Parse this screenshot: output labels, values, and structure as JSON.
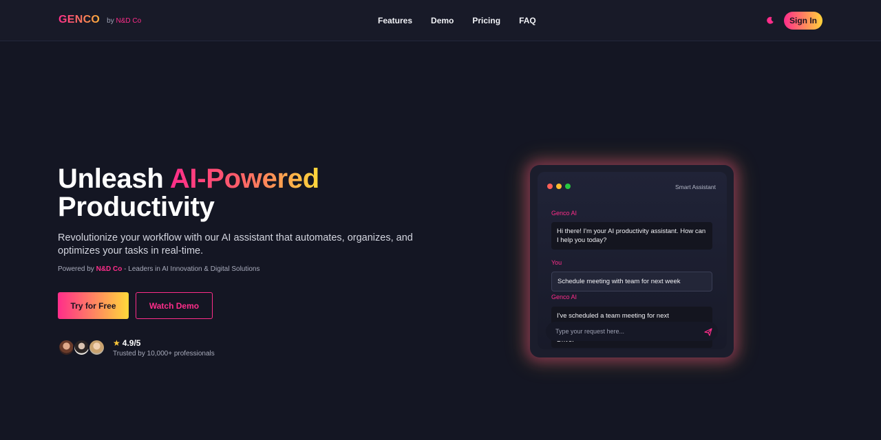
{
  "nav": {
    "brand": "GENCO",
    "by_prefix": "by",
    "by_company": "N&D Co",
    "links": [
      "Features",
      "Demo",
      "Pricing",
      "FAQ"
    ],
    "theme_icon": "moon-icon",
    "signin_label": "Sign In"
  },
  "hero": {
    "title_white": "Unleash ",
    "title_gradient": "AI-Powered",
    "title_line2": "Productivity",
    "subtitle": "Revolutionize your workflow with our AI assistant that automates, organizes, and optimizes your tasks in real-time.",
    "powered_prefix": "Powered by ",
    "powered_company": "N&D Co",
    "powered_suffix": " - Leaders in AI Innovation & Digital Solutions",
    "cta_primary": "Try for Free",
    "cta_secondary": "Watch Demo",
    "rating": "4.9/5",
    "trusted": "Trusted by 10,000+ professionals"
  },
  "chat": {
    "title": "Smart Assistant",
    "messages": [
      {
        "sender": "Genco AI",
        "text": "Hi there! I'm your AI productivity assistant. How can I help you today?"
      },
      {
        "sender": "You",
        "text": "Schedule meeting with team for next week"
      },
      {
        "sender": "Genco AI",
        "text": "I've scheduled a team meeting for next"
      }
    ],
    "overflow_text": "Drive.",
    "input_placeholder": "Type your request here...",
    "send_icon": "send-icon"
  },
  "colors": {
    "accent_pink": "#ff2d8a",
    "accent_yellow": "#ffd93a",
    "background": "#141623",
    "dot_red": "#ff5f57",
    "dot_yellow": "#febc2e",
    "dot_green": "#28c840"
  }
}
